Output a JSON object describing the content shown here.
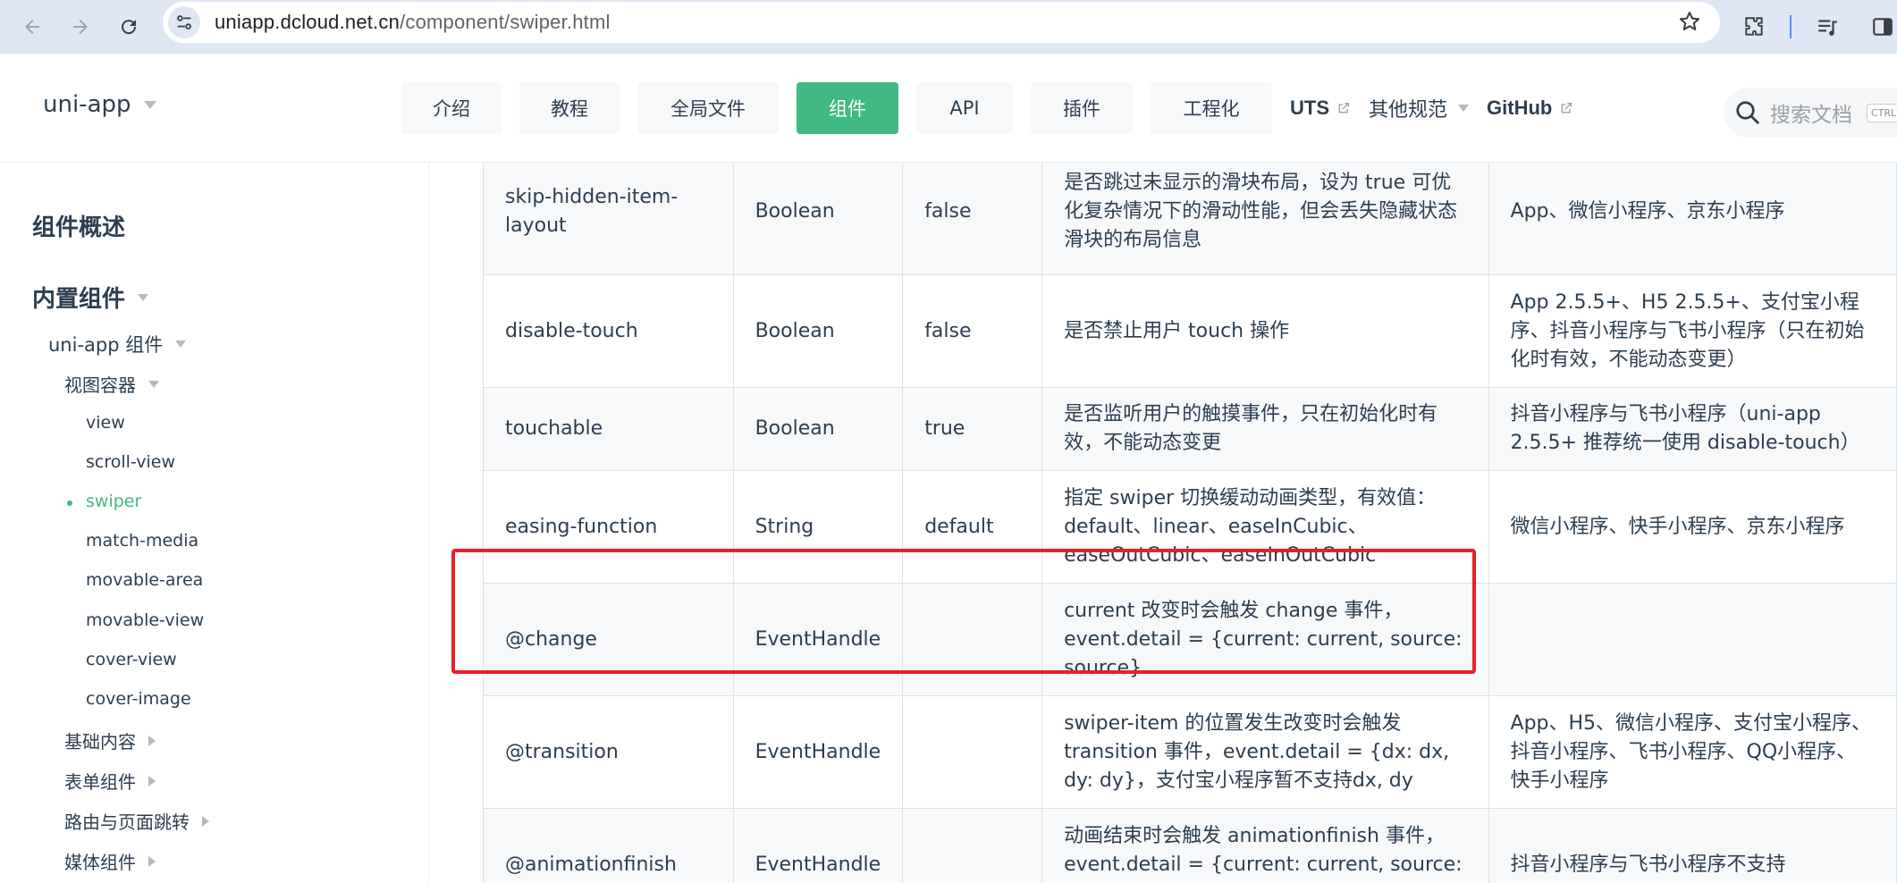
{
  "browser": {
    "url_host": "uniapp.dcloud.net.cn",
    "url_path": "/component/swiper.html"
  },
  "header": {
    "brand": "uni-app",
    "nav": [
      {
        "label": "介绍"
      },
      {
        "label": "教程"
      },
      {
        "label": "全局文件"
      },
      {
        "label": "组件"
      },
      {
        "label": "API"
      },
      {
        "label": "插件"
      },
      {
        "label": "工程化"
      }
    ],
    "links": {
      "uts": "UTS",
      "other": "其他规范",
      "github": "GitHub"
    },
    "search_placeholder": "搜索文档",
    "search_kbd": "CTRL"
  },
  "sidebar": {
    "overview": "组件概述",
    "builtin": "内置组件",
    "uniapp_components": "uni-app 组件",
    "view_container": "视图容器",
    "items": [
      "view",
      "scroll-view",
      "swiper",
      "match-media",
      "movable-area",
      "movable-view",
      "cover-view",
      "cover-image"
    ],
    "basic": "基础内容",
    "form": "表单组件",
    "routing": "路由与页面跳转",
    "media": "媒体组件"
  },
  "table": {
    "rows": [
      {
        "name": "skip-hidden-item-layout",
        "type": "Boolean",
        "default": "false",
        "desc": "是否跳过未显示的滑块布局，设为 true 可优化复杂情况下的滑动性能，但会丢失隐藏状态滑块的布局信息",
        "platform": "App、微信小程序、京东小程序"
      },
      {
        "name": "disable-touch",
        "type": "Boolean",
        "default": "false",
        "desc": "是否禁止用户 touch 操作",
        "platform": "App 2.5.5+、H5 2.5.5+、支付宝小程序、抖音小程序与飞书小程序（只在初始化时有效，不能动态变更）"
      },
      {
        "name": "touchable",
        "type": "Boolean",
        "default": "true",
        "desc": "是否监听用户的触摸事件，只在初始化时有效，不能动态变更",
        "platform": "抖音小程序与飞书小程序（uni-app 2.5.5+ 推荐统一使用 disable-touch）"
      },
      {
        "name": "easing-function",
        "type": "String",
        "default": "default",
        "desc": "指定 swiper 切换缓动动画类型，有效值：default、linear、easeInCubic、easeOutCubic、easeInOutCubic",
        "platform": "微信小程序、快手小程序、京东小程序"
      },
      {
        "name": "@change",
        "type": "EventHandle",
        "default": "",
        "desc": "current 改变时会触发 change 事件，event.detail = {current: current, source: source}",
        "platform": ""
      },
      {
        "name": "@transition",
        "type": "EventHandle",
        "default": "",
        "desc": "swiper-item 的位置发生改变时会触发 transition 事件，event.detail = {dx: dx, dy: dy}，支付宝小程序暂不支持dx, dy",
        "platform": "App、H5、微信小程序、支付宝小程序、抖音小程序、飞书小程序、QQ小程序、快手小程序"
      },
      {
        "name": "@animationfinish",
        "type": "EventHandle",
        "default": "",
        "desc": "动画结束时会触发 animationfinish 事件，event.detail = {current: current, source: source}",
        "platform": "抖音小程序与飞书小程序不支持"
      }
    ]
  },
  "colors": {
    "accent": "#42b983",
    "highlight": "#e8202a",
    "browser_bar": "#dfe7f5"
  }
}
